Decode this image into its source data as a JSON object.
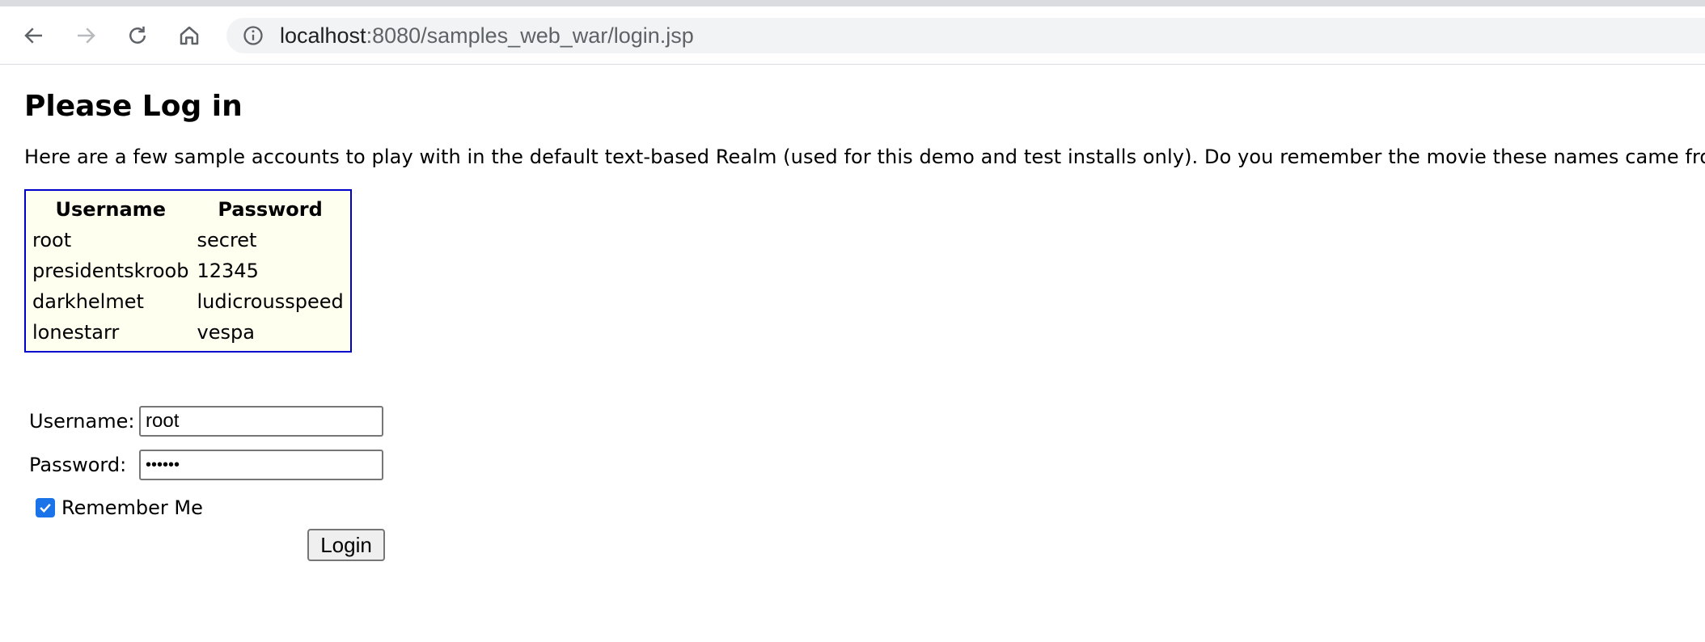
{
  "browser": {
    "url_host": "localhost",
    "url_rest": ":8080/samples_web_war/login.jsp",
    "icons": [
      "back-arrow-icon",
      "forward-arrow-icon",
      "reload-icon",
      "home-icon",
      "info-icon"
    ]
  },
  "page": {
    "heading": "Please Log in",
    "intro": "Here are a few sample accounts to play with in the default text-based Realm (used for this demo and test installs only). Do you remember the movie these names came from? ;)"
  },
  "accounts": {
    "headers": [
      "Username",
      "Password"
    ],
    "rows": [
      [
        "root",
        "secret"
      ],
      [
        "presidentskroob",
        "12345"
      ],
      [
        "darkhelmet",
        "ludicrousspeed"
      ],
      [
        "lonestarr",
        "vespa"
      ]
    ],
    "border_color": "#0000cc",
    "background_color": "#fffff0"
  },
  "form": {
    "username_label": "Username:",
    "username_value": "root",
    "password_label": "Password:",
    "password_value": "••••••",
    "remember_label": "Remember Me",
    "remember_checked": true,
    "login_label": "Login"
  },
  "colors": {
    "checkbox_accent": "#1a73e8"
  }
}
